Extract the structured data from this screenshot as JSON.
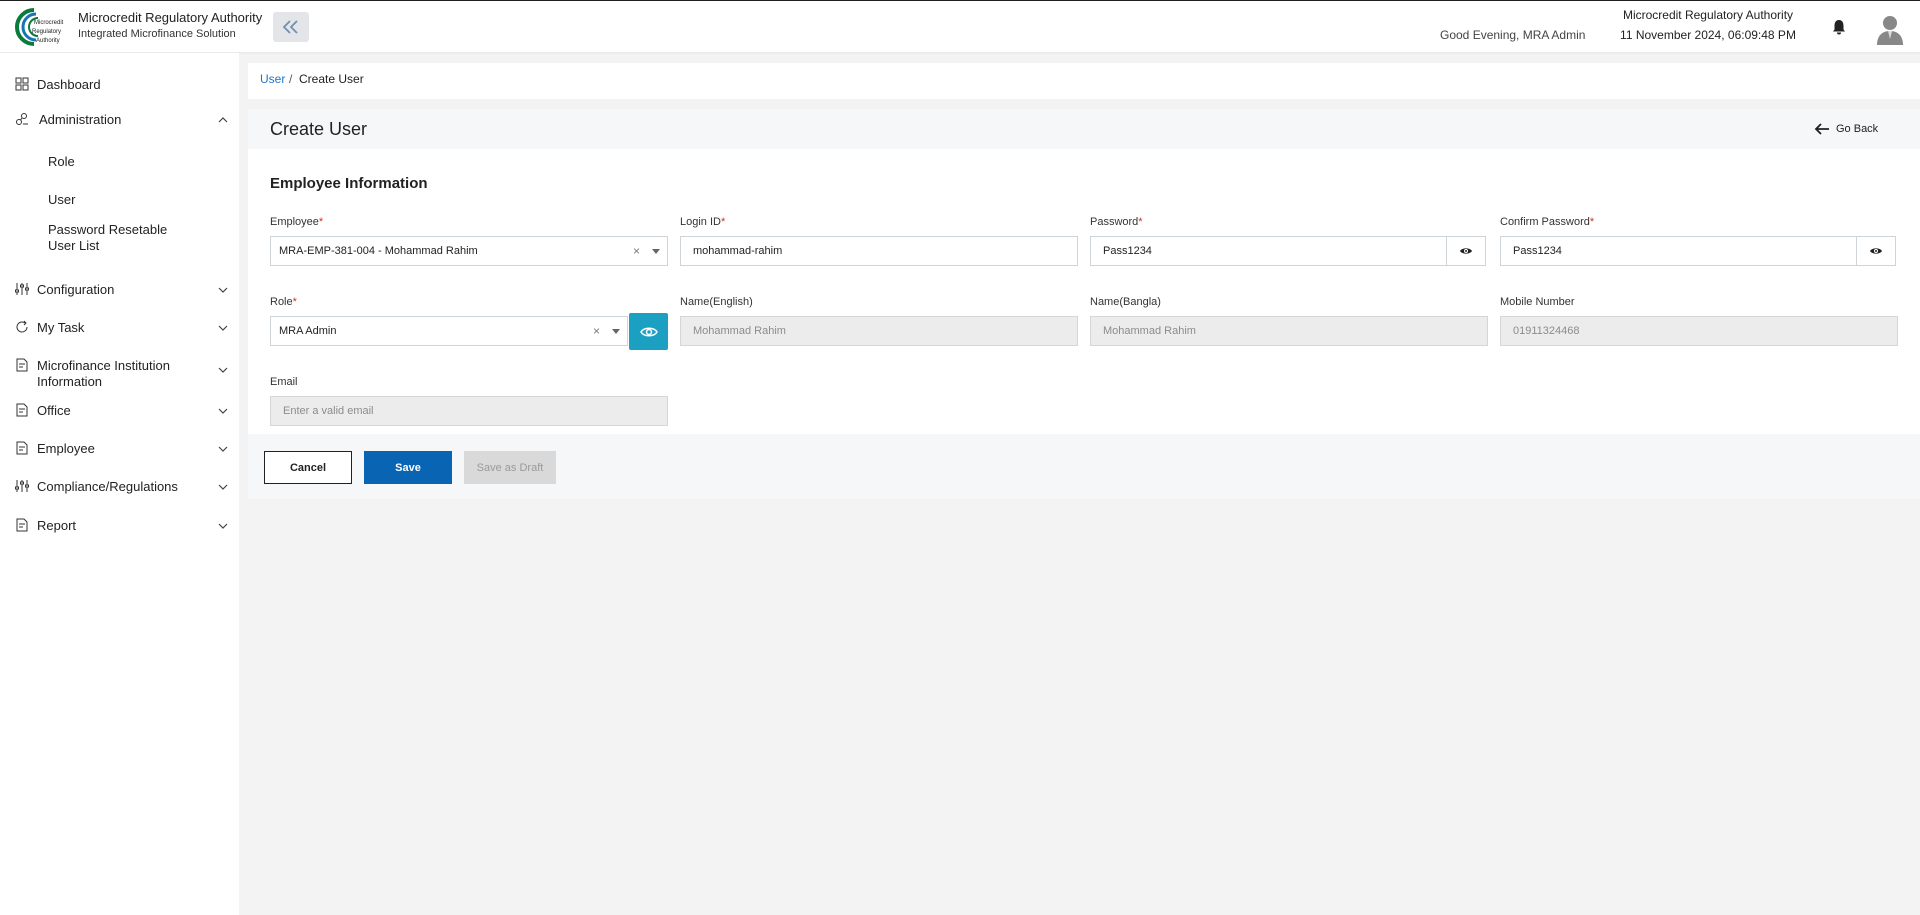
{
  "header": {
    "brand_title": "Microcredit Regulatory Authority",
    "brand_subtitle": "Integrated Microfinance Solution",
    "logo_text": [
      "Microcredit",
      "Regulatory",
      "Authority"
    ],
    "greeting": "Good Evening, MRA Admin",
    "org_name": "Microcredit Regulatory Authority",
    "datetime": "11 November 2024, 06:09:48 PM",
    "icons": {
      "collapse": "double-chevron-left-icon",
      "bell": "bell-icon",
      "avatar": "user-avatar-icon"
    }
  },
  "sidebar": {
    "items": [
      {
        "label": "Dashboard",
        "icon": "grid-icon"
      },
      {
        "label": "Administration",
        "icon": "admin-icon",
        "expanded": true
      },
      {
        "label": "Configuration",
        "icon": "sliders-icon"
      },
      {
        "label": "My Task",
        "icon": "task-icon"
      },
      {
        "label": "Microfinance Institution Information",
        "icon": "document-icon"
      },
      {
        "label": "Office",
        "icon": "document-icon"
      },
      {
        "label": "Employee",
        "icon": "document-icon"
      },
      {
        "label": "Compliance/Regulations",
        "icon": "sliders-icon"
      },
      {
        "label": "Report",
        "icon": "document-icon"
      }
    ],
    "sub_items": [
      "Role",
      "User",
      "Password Resetable User List"
    ]
  },
  "breadcrumb": {
    "parent": "User",
    "separator": "/",
    "current": "Create User"
  },
  "page": {
    "title": "Create User",
    "go_back": "Go Back",
    "section_title": "Employee Information"
  },
  "form": {
    "employee": {
      "label": "Employee",
      "value": "MRA-EMP-381-004 - Mohammad Rahim"
    },
    "login_id": {
      "label": "Login ID",
      "value": "mohammad-rahim"
    },
    "password": {
      "label": "Password",
      "value": "Pass1234"
    },
    "confirm_password": {
      "label": "Confirm Password",
      "value": "Pass1234"
    },
    "role": {
      "label": "Role",
      "value": "MRA Admin"
    },
    "name_english": {
      "label": "Name(English)",
      "value": "Mohammad Rahim"
    },
    "name_bangla": {
      "label": "Name(Bangla)",
      "value": "Mohammad Rahim"
    },
    "mobile": {
      "label": "Mobile Number",
      "value": "01911324468"
    },
    "email": {
      "label": "Email",
      "placeholder": "Enter a valid email"
    },
    "required_mark": "*",
    "clear_glyph": "×"
  },
  "actions": {
    "cancel": "Cancel",
    "save": "Save",
    "save_draft": "Save as Draft"
  },
  "colors": {
    "primary": "#0a64b4",
    "accent": "#1ba0c2",
    "link": "#1f76c8",
    "required": "#d32f2f"
  }
}
